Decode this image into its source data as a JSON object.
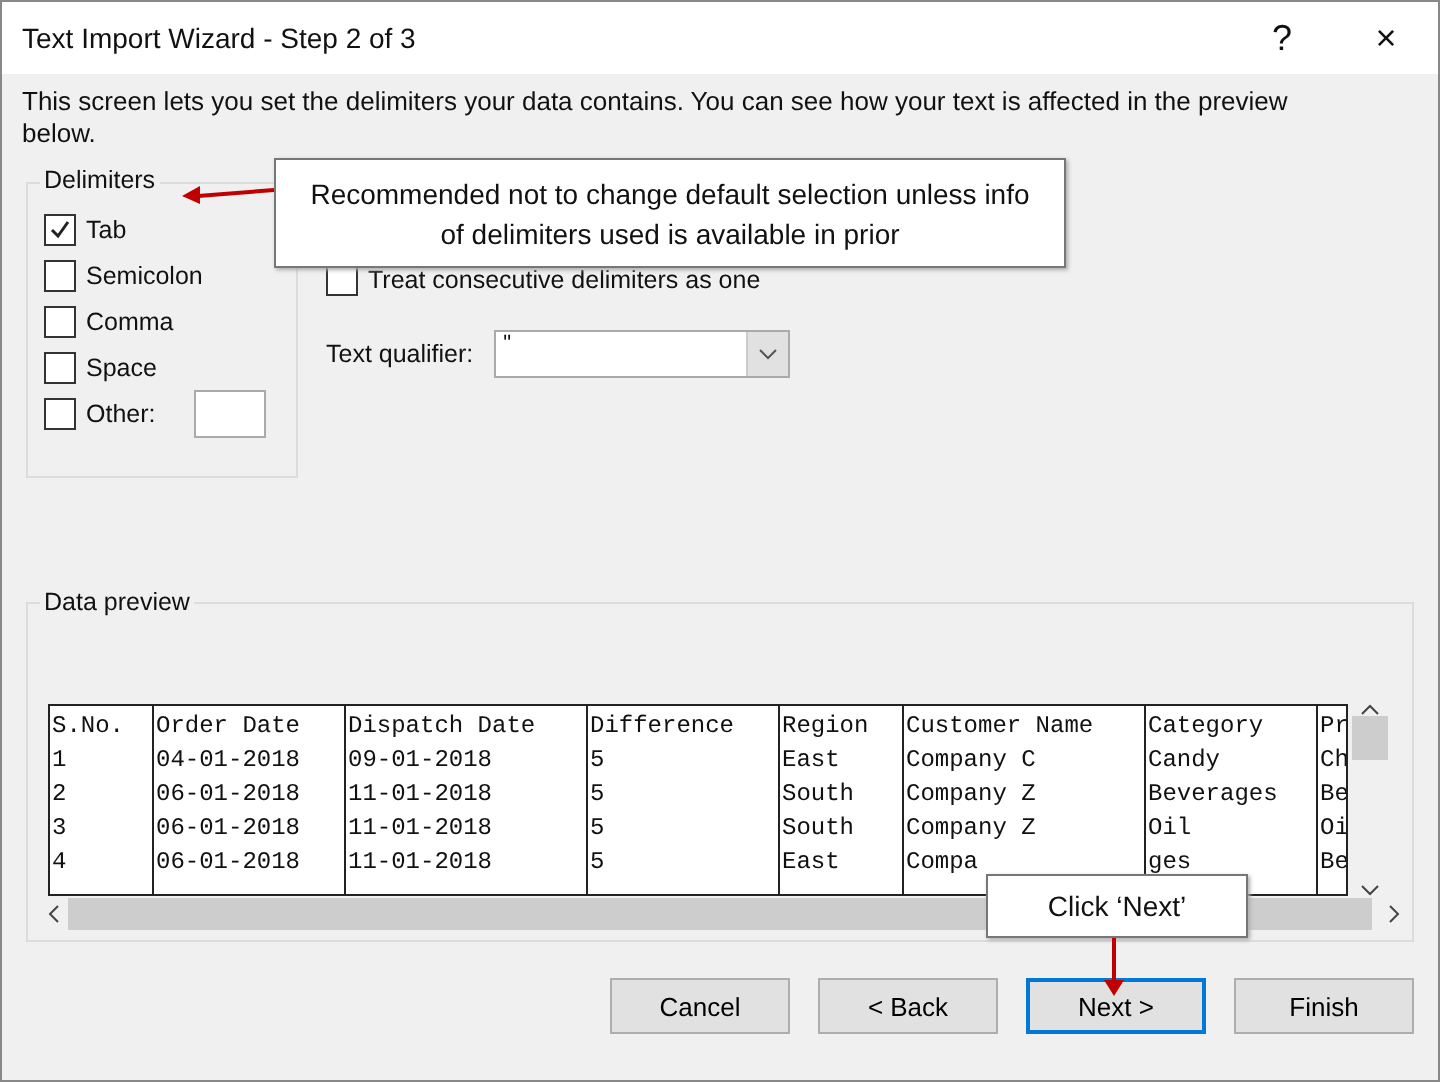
{
  "window": {
    "title": "Text Import Wizard - Step 2 of 3",
    "help": "?",
    "close": "×"
  },
  "intro": "This screen lets you set the delimiters your data contains.  You can see how your text is affected in the preview below.",
  "delimiters": {
    "title": "Delimiters",
    "items": [
      {
        "label": "Tab",
        "checked": true
      },
      {
        "label": "Semicolon",
        "checked": false
      },
      {
        "label": "Comma",
        "checked": false
      },
      {
        "label": "Space",
        "checked": false
      },
      {
        "label": "Other:",
        "checked": false,
        "kind": "other"
      }
    ]
  },
  "consecutive": {
    "label": "Treat consecutive delimiters as one",
    "checked": false
  },
  "qualifier": {
    "label": "Text qualifier:",
    "value": "\""
  },
  "preview": {
    "title": "Data preview",
    "columns": [
      "S.No.",
      "Order Date",
      "Dispatch Date",
      "Difference",
      "Region",
      "Customer Name",
      "Category",
      "Pr"
    ],
    "rows": [
      [
        "1",
        "04-01-2018",
        "09-01-2018",
        "5",
        "East",
        "Company C",
        "Candy",
        "Ch"
      ],
      [
        "2",
        "06-01-2018",
        "11-01-2018",
        "5",
        "South",
        "Company Z",
        "Beverages",
        "Be"
      ],
      [
        "3",
        "06-01-2018",
        "11-01-2018",
        "5",
        "South",
        "Company Z",
        "Oil",
        "Oi"
      ],
      [
        "4",
        "06-01-2018",
        "11-01-2018",
        "5",
        "East",
        "Compa",
        "ges",
        "Be"
      ]
    ]
  },
  "callouts": [
    {
      "text": "Recommended not to change default selection unless info of delimiters used is available in prior",
      "kind": "left"
    },
    {
      "text": "Click ‘Next’",
      "kind": "down"
    }
  ],
  "buttons": [
    {
      "label": "Cancel",
      "selected": false
    },
    {
      "label": "< Back",
      "selected": false
    },
    {
      "label": "Next >",
      "selected": true
    },
    {
      "label": "Finish",
      "selected": false
    }
  ]
}
